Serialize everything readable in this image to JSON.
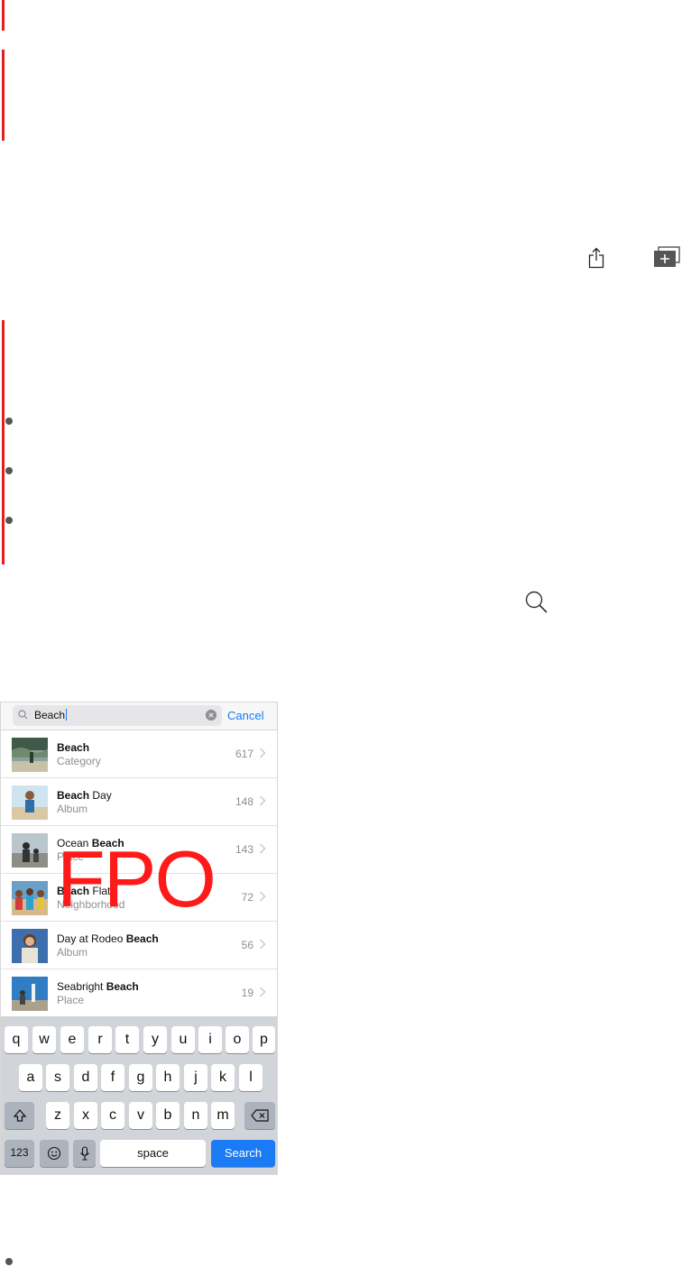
{
  "search": {
    "query": "Beach",
    "cancel_label": "Cancel"
  },
  "results": [
    {
      "title_bold": "Beach",
      "title_rest": "",
      "title_prefix": "",
      "subtitle": "Category",
      "count": "617"
    },
    {
      "title_bold": "Beach",
      "title_rest": " Day",
      "title_prefix": "",
      "subtitle": "Album",
      "count": "148"
    },
    {
      "title_bold": "Beach",
      "title_rest": "",
      "title_prefix": "Ocean ",
      "subtitle": "Place",
      "count": "143"
    },
    {
      "title_bold": "Beach",
      "title_rest": " Flat",
      "title_prefix": "",
      "subtitle": "Neighborhood",
      "count": "72"
    },
    {
      "title_bold": "Beach",
      "title_rest": "",
      "title_prefix": "Day at Rodeo ",
      "subtitle": "Album",
      "count": "56"
    },
    {
      "title_bold": "Beach",
      "title_rest": "",
      "title_prefix": "Seabright ",
      "subtitle": "Place",
      "count": "19"
    }
  ],
  "overlay_text": "FPO",
  "keyboard": {
    "row1": [
      "q",
      "w",
      "e",
      "r",
      "t",
      "y",
      "u",
      "i",
      "o",
      "p"
    ],
    "row2": [
      "a",
      "s",
      "d",
      "f",
      "g",
      "h",
      "j",
      "k",
      "l"
    ],
    "row3": [
      "z",
      "x",
      "c",
      "v",
      "b",
      "n",
      "m"
    ],
    "numbers_label": "123",
    "space_label": "space",
    "return_label": "Search"
  },
  "icons": {
    "share": "share-icon",
    "add_album": "add-album-icon",
    "search": "search-icon",
    "shift": "shift-icon",
    "delete": "delete-icon",
    "emoji": "emoji-icon",
    "mic": "mic-icon"
  },
  "colors": {
    "accent": "#1a7bf5",
    "marker": "#e02020",
    "fpo": "#ff1a1a"
  }
}
